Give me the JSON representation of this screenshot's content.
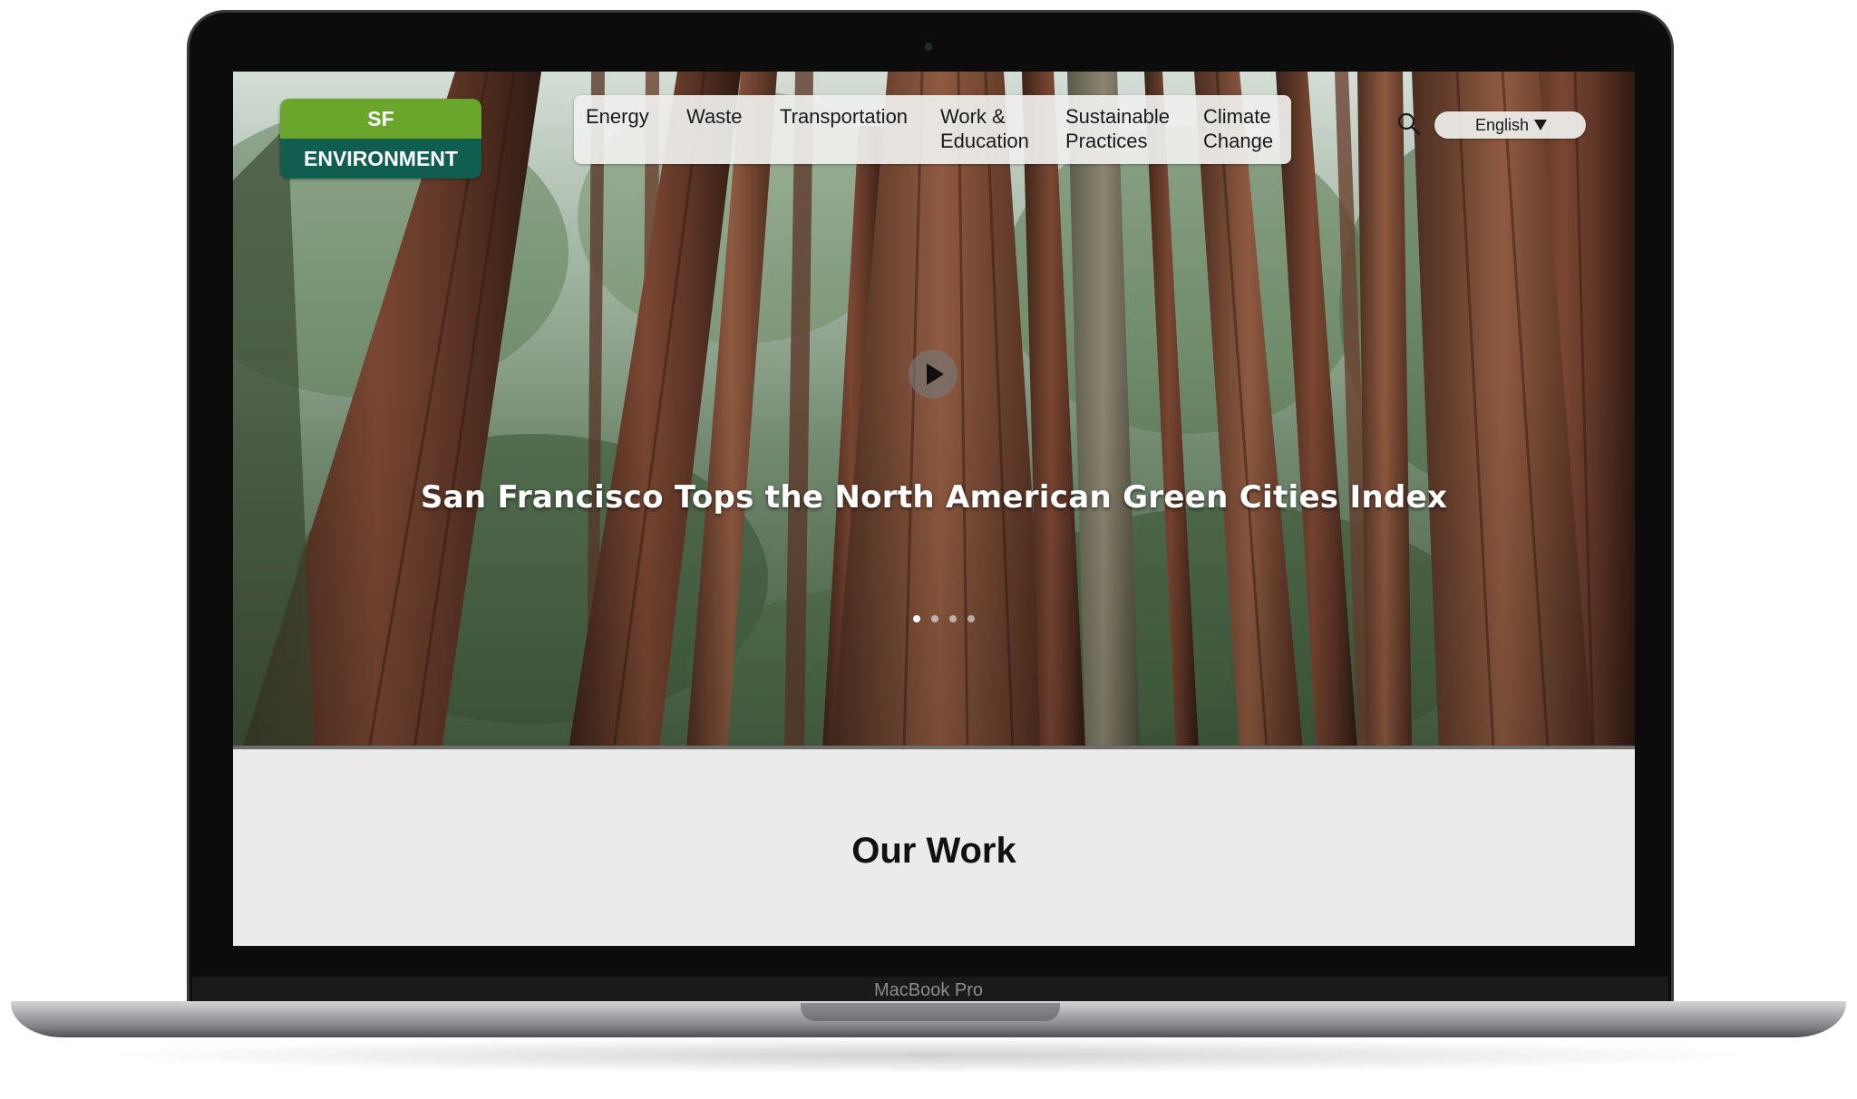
{
  "device": {
    "model_label": "MacBook Pro"
  },
  "logo": {
    "line1": "SF",
    "line2": "ENVIRONMENT",
    "colors": {
      "top": "#6aa62c",
      "bottom": "#0f5e50"
    }
  },
  "nav": {
    "items": [
      {
        "label_line1": "Energy",
        "label_line2": ""
      },
      {
        "label_line1": "Waste",
        "label_line2": ""
      },
      {
        "label_line1": "Transportation",
        "label_line2": ""
      },
      {
        "label_line1": "Work &",
        "label_line2": "Education"
      },
      {
        "label_line1": "Sustainable",
        "label_line2": "Practices"
      },
      {
        "label_line1": "Climate",
        "label_line2": "Change"
      }
    ]
  },
  "search": {
    "icon": "search-icon"
  },
  "language": {
    "selected": "English",
    "icon": "caret-down-icon"
  },
  "hero": {
    "headline": "San Francisco Tops the North American Green Cities Index",
    "play_icon": "play-icon",
    "slides": {
      "count": 4,
      "active": 1
    }
  },
  "section": {
    "title": "Our Work"
  }
}
